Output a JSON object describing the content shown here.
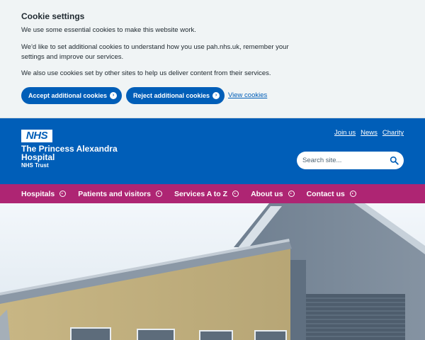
{
  "cookie": {
    "title": "Cookie settings",
    "p1": "We use some essential cookies to make this website work.",
    "p2": "We'd like to set additional cookies to understand how you use pah.nhs.uk, remember your settings and improve our services.",
    "p3": "We also use cookies set by other sites to help us deliver content from their services.",
    "accept_label": "Accept additional cookies",
    "reject_label": "Reject additional cookies",
    "view_label": "View cookies"
  },
  "header": {
    "logo": "NHS",
    "org_name": "The Princess Alexandra Hospital",
    "org_sub": "NHS Trust",
    "links": [
      "Join us",
      "News",
      "Charity"
    ],
    "search_placeholder": "Search site..."
  },
  "nav": {
    "items": [
      "Hospitals",
      "Patients and visitors",
      "Services A to Z",
      "About us",
      "Contact us"
    ]
  },
  "colors": {
    "nhs_blue": "#005eb8",
    "nav_pink": "#ae2573",
    "banner_bg": "#f0f4f5"
  }
}
